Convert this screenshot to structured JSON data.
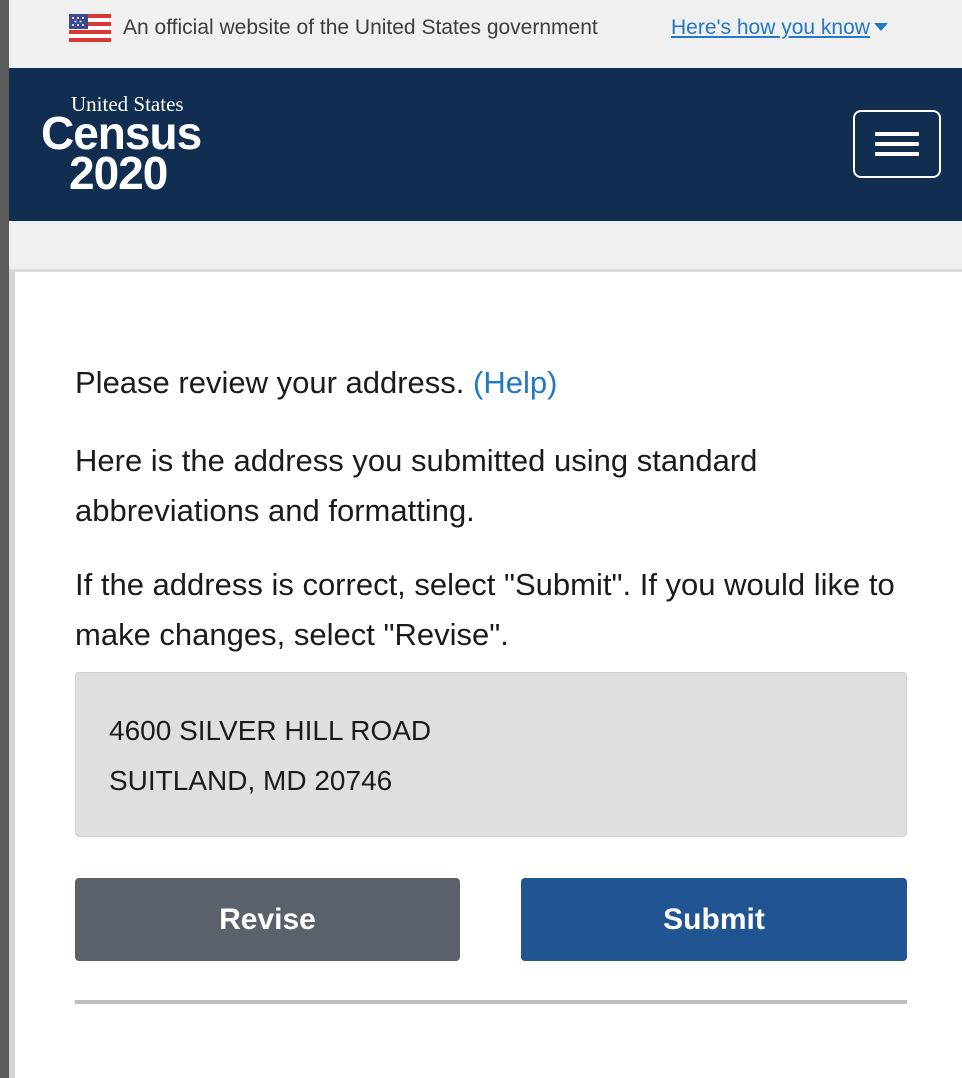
{
  "gov_banner": {
    "text": "An official website of the United States government",
    "link_label": "Here's how you know",
    "icons": {
      "flag": "us-flag-icon",
      "caret": "caret-down-icon"
    }
  },
  "header": {
    "logo": {
      "line1": "United States",
      "line2": "Census",
      "line3": "2020"
    },
    "menu_icon": "hamburger-menu-icon"
  },
  "content": {
    "prompt": "Please review your address.",
    "help_link": "(Help)",
    "explanation": "Here is the address you submitted using standard abbreviations and formatting.",
    "instruction": "If the address is correct, select \"Submit\". If you would like to make changes, select \"Revise\"."
  },
  "address": {
    "line1": "4600 SILVER HILL ROAD",
    "line2": "SUITLAND, MD 20746"
  },
  "buttons": {
    "revise": "Revise",
    "submit": "Submit"
  },
  "colors": {
    "header_bg": "#112e51",
    "link": "#2378c3",
    "revise_bg": "#5b616b",
    "submit_bg": "#205493",
    "address_bg": "#dfdfdf"
  }
}
